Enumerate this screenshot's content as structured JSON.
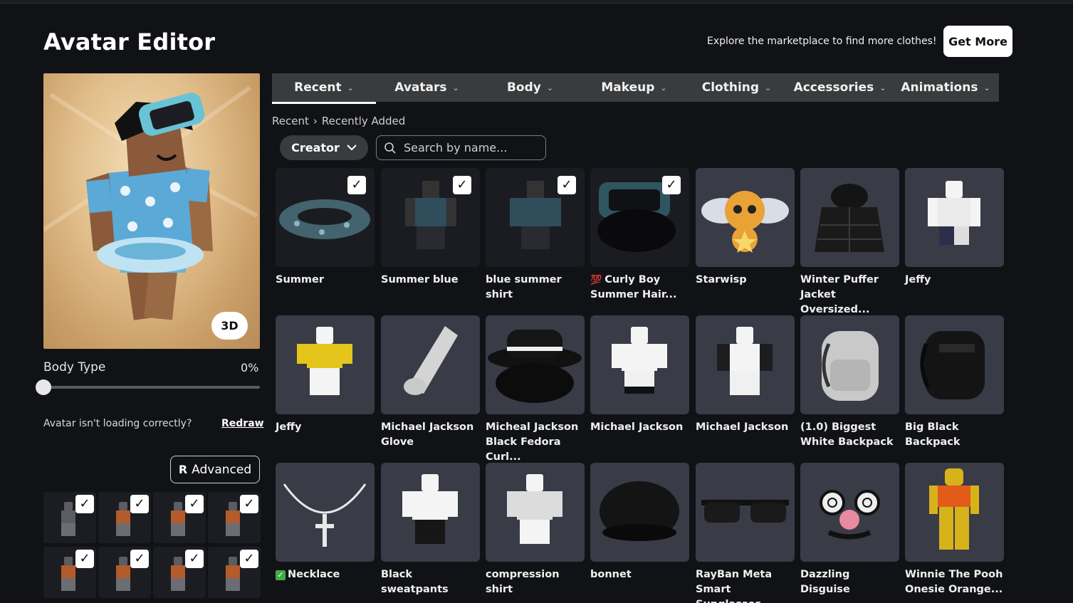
{
  "page": {
    "title": "Avatar Editor"
  },
  "header": {
    "explore_text": "Explore the marketplace to find more clothes!",
    "get_more_label": "Get More"
  },
  "preview": {
    "toggle_3d_label": "3D"
  },
  "body_type": {
    "label": "Body Type",
    "value_text": "0%",
    "value": 0
  },
  "redraw": {
    "question": "Avatar isn't loading correctly?",
    "link_label": "Redraw"
  },
  "advanced": {
    "label": "Advanced"
  },
  "outfits": [
    {
      "checked": true
    },
    {
      "checked": true
    },
    {
      "checked": true
    },
    {
      "checked": true
    },
    {
      "checked": true
    },
    {
      "checked": true
    },
    {
      "checked": true
    },
    {
      "checked": true
    }
  ],
  "tabs": [
    {
      "label": "Recent",
      "active": true
    },
    {
      "label": "Avatars"
    },
    {
      "label": "Body"
    },
    {
      "label": "Makeup"
    },
    {
      "label": "Clothing"
    },
    {
      "label": "Accessories"
    },
    {
      "label": "Animations"
    }
  ],
  "breadcrumb": {
    "root": "Recent",
    "separator": "›",
    "current": "Recently Added"
  },
  "filter": {
    "creator_label": "Creator"
  },
  "search": {
    "placeholder": "Search by name..."
  },
  "items": [
    {
      "name": "Summer",
      "checked": true,
      "icon": "swim-ring-icon"
    },
    {
      "name": "Summer blue",
      "checked": true,
      "icon": "outfit-icon"
    },
    {
      "name": "blue summer shirt",
      "checked": true,
      "icon": "shirt-icon"
    },
    {
      "name": "Curly Boy Summer Hair...",
      "prefix": "💯",
      "checked": true,
      "icon": "hair-goggles-icon"
    },
    {
      "name": "Starwisp",
      "checked": false,
      "icon": "bee-icon"
    },
    {
      "name": "Winter Puffer Jacket Oversized...",
      "checked": false,
      "icon": "jacket-icon"
    },
    {
      "name": "Jeffy",
      "checked": false,
      "icon": "avatar-icon"
    },
    {
      "name": "Jeffy",
      "checked": false,
      "icon": "yellow-shirt-icon"
    },
    {
      "name": "Michael Jackson Glove",
      "checked": false,
      "icon": "glove-icon"
    },
    {
      "name": "Micheal Jackson Black Fedora Curl...",
      "checked": false,
      "icon": "fedora-icon"
    },
    {
      "name": "Michael Jackson",
      "checked": false,
      "icon": "avatar-icon"
    },
    {
      "name": "Michael Jackson",
      "checked": false,
      "icon": "avatar-jacket-icon"
    },
    {
      "name": "(1.0) Biggest White Backpack",
      "checked": false,
      "icon": "white-backpack-icon"
    },
    {
      "name": "Big Black Backpack",
      "checked": false,
      "icon": "black-backpack-icon"
    },
    {
      "name": "Necklace",
      "prefix": "✅",
      "checked": false,
      "icon": "necklace-icon"
    },
    {
      "name": "Black sweatpants",
      "checked": false,
      "icon": "pants-icon"
    },
    {
      "name": "compression shirt",
      "checked": false,
      "icon": "shirt-icon"
    },
    {
      "name": "bonnet",
      "checked": false,
      "icon": "bonnet-icon"
    },
    {
      "name": "RayBan Meta Smart Sunglasses...",
      "checked": false,
      "icon": "sunglasses-icon"
    },
    {
      "name": "Dazzling Disguise",
      "checked": false,
      "icon": "disguise-glasses-icon"
    },
    {
      "name": "Winnie The Pooh Onesie Orange...",
      "checked": false,
      "icon": "onesie-icon"
    }
  ]
}
